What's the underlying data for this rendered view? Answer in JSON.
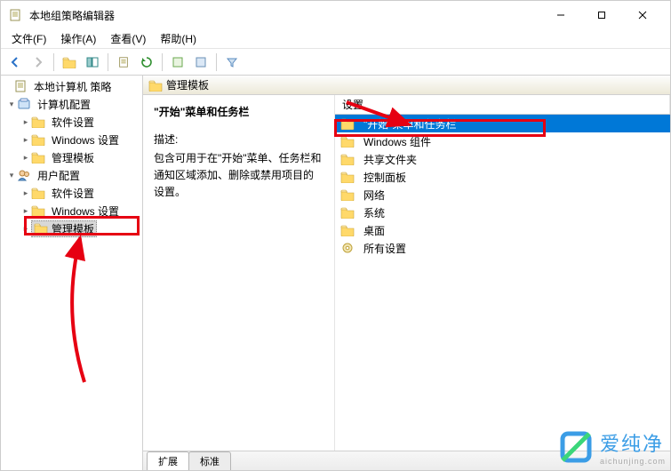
{
  "titlebar": {
    "title": "本地组策略编辑器"
  },
  "menubar": [
    {
      "label": "文件(F)"
    },
    {
      "label": "操作(A)"
    },
    {
      "label": "查看(V)"
    },
    {
      "label": "帮助(H)"
    }
  ],
  "tree": {
    "root": {
      "label": "本地计算机 策略"
    },
    "computer": {
      "label": "计算机配置",
      "children": [
        {
          "label": "软件设置"
        },
        {
          "label": "Windows 设置"
        },
        {
          "label": "管理模板"
        }
      ]
    },
    "user": {
      "label": "用户配置",
      "children": [
        {
          "label": "软件设置"
        },
        {
          "label": "Windows 设置"
        },
        {
          "label": "管理模板"
        }
      ]
    }
  },
  "path_header": "管理模板",
  "detail": {
    "title": "\"开始\"菜单和任务栏",
    "sub": "描述:",
    "desc": "包含可用于在\"开始\"菜单、任务栏和通知区域添加、删除或禁用项目的设置。"
  },
  "list": {
    "header": "设置",
    "items": [
      {
        "label": "\"开始\"菜单和任务栏",
        "selected": true
      },
      {
        "label": "Windows 组件"
      },
      {
        "label": "共享文件夹"
      },
      {
        "label": "控制面板"
      },
      {
        "label": "网络"
      },
      {
        "label": "系统"
      },
      {
        "label": "桌面"
      },
      {
        "label": "所有设置",
        "icon": "gear"
      }
    ]
  },
  "tabs": {
    "extended": "扩展",
    "standard": "标准"
  },
  "watermark": {
    "text": "爱纯净",
    "sub": "aichunjing.com"
  }
}
